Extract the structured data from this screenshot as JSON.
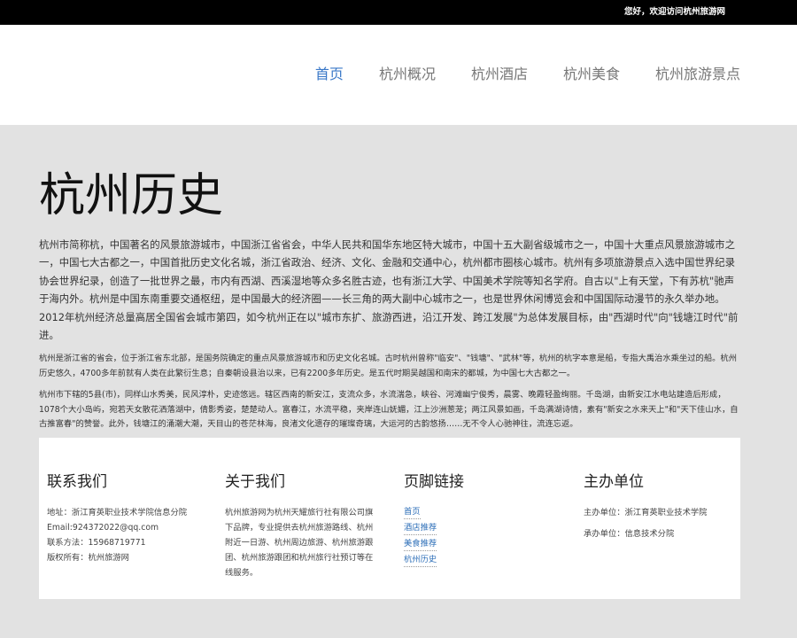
{
  "topbar": {
    "welcome": "您好，欢迎访问杭州旅游网"
  },
  "nav": {
    "items": [
      {
        "label": "首页",
        "active": true
      },
      {
        "label": "杭州概况",
        "active": false
      },
      {
        "label": "杭州酒店",
        "active": false
      },
      {
        "label": "杭州美食",
        "active": false
      },
      {
        "label": "杭州旅游景点",
        "active": false
      }
    ]
  },
  "main": {
    "title": "杭州历史",
    "intro": "杭州市简称杭，中国著名的风景旅游城市，中国浙江省省会，中华人民共和国华东地区特大城市，中国十五大副省级城市之一，中国十大重点风景旅游城市之一，中国七大古都之一，中国首批历史文化名城，浙江省政治、经济、文化、金融和交通中心，杭州都市圈核心城市。杭州有多项旅游景点入选中国世界纪录协会世界纪录，创造了一批世界之最，市内有西湖、西溪湿地等众多名胜古迹，也有浙江大学、中国美术学院等知名学府。自古以\"上有天堂，下有苏杭\"驰声于海内外。杭州是中国东南重要交通枢纽，是中国最大的经济圈——长三角的两大副中心城市之一，也是世界休闲博览会和中国国际动漫节的永久举办地。2012年杭州经济总量高居全国省会城市第四，如今杭州正在以\"城市东扩、旅游西进，沿江开发、跨江发展\"为总体发展目标，由\"西湖时代\"向\"钱塘江时代\"前进。",
    "para1": "杭州是浙江省的省会，位于浙江省东北部，是国务院确定的重点风景旅游城市和历史文化名城。古时杭州曾称\"临安\"、\"钱塘\"、\"武林\"等，杭州的杭字本意是船，专指大禹治水乘坐过的船。杭州历史悠久，4700多年前就有人类在此繁衍生息；自秦朝设县治以来，已有2200多年历史。是五代时期吴越国和南宋的都城，为中国七大古都之一。",
    "para2": "杭州市下辖的5县(市)，同样山水秀美，民风淳朴，史迹悠远。辖区西南的新安江，支流众多，水流湍急，峡谷、河滩幽宁俊秀，晨雾、晚霞轻盈绚丽。千岛湖，由新安江水电站建造后形成，1078个大小岛屿，宛若天女散花洒落湖中，倩影秀姿，楚楚动人。富春江，水流平稳，夹岸连山妩媚，江上沙洲葱茏；两江风景如画，千岛满湖诗情，素有\"新安之水来天上\"和\"天下佳山水，自古推富春\"的赞誉。此外，钱塘江的涌潮大潮，天目山的苍茫林海，良渚文化遗存的璀璨奇璃，大运河的古韵悠扬……无不令人心驰神往，流连忘返。"
  },
  "footer": {
    "contact": {
      "title": "联系我们",
      "lines": [
        "地址：浙江育英职业技术学院信息分院",
        "Email:924372022@qq.com",
        "联系方法：15968719771",
        "版权所有：杭州旅游网"
      ]
    },
    "about": {
      "title": "关于我们",
      "text": "杭州旅游网为杭州天耀旅行社有限公司旗下品牌，专业提供去杭州旅游路线、杭州附近一日游、杭州周边旅游、杭州旅游跟团、杭州旅游跟团和杭州旅行社预订等在线服务。"
    },
    "links": {
      "title": "页脚链接",
      "items": [
        "首页",
        "酒店推荐",
        "美食推荐",
        "杭州历史"
      ]
    },
    "sponsor": {
      "title": "主办单位",
      "host": "主办单位：浙江育英职业技术学院",
      "organizer": "承办单位：信息技术分院"
    }
  }
}
